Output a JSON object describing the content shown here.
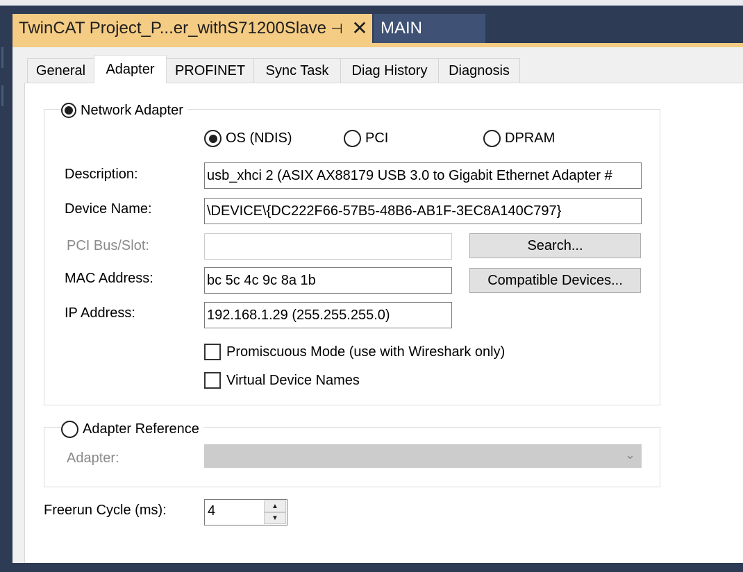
{
  "document_tabs": {
    "active_title": "TwinCAT Project_P...er_withS71200Slave",
    "pin_glyph": "⊣",
    "close_glyph": "✕",
    "other_tab": "MAIN"
  },
  "property_tabs": [
    "General",
    "Adapter",
    "PROFINET",
    "Sync Task",
    "Diag History",
    "Diagnosis"
  ],
  "active_tab": "Adapter",
  "network_adapter": {
    "label": "Network Adapter",
    "selected": true,
    "mode_options": [
      {
        "label": "OS (NDIS)",
        "selected": true
      },
      {
        "label": "PCI",
        "selected": false
      },
      {
        "label": "DPRAM",
        "selected": false
      }
    ],
    "description_label": "Description:",
    "description_value": "usb_xhci 2 (ASIX AX88179 USB 3.0 to Gigabit Ethernet Adapter #",
    "device_name_label": "Device Name:",
    "device_name_value": "\\DEVICE\\{DC222F66-57B5-48B6-AB1F-3EC8A140C797}",
    "pci_label": "PCI Bus/Slot:",
    "pci_value": "",
    "search_button": "Search...",
    "mac_label": "MAC Address:",
    "mac_value": "bc 5c 4c 9c 8a 1b",
    "compatible_button": "Compatible Devices...",
    "ip_label": "IP Address:",
    "ip_value": "192.168.1.29 (255.255.255.0)",
    "promiscuous_label": "Promiscuous Mode (use with Wireshark only)",
    "promiscuous_checked": false,
    "virtual_names_label": "Virtual Device Names",
    "virtual_names_checked": false
  },
  "adapter_reference": {
    "label": "Adapter Reference",
    "selected": false,
    "adapter_label": "Adapter:",
    "adapter_value": ""
  },
  "freerun": {
    "label": "Freerun Cycle (ms):",
    "value": "4"
  }
}
